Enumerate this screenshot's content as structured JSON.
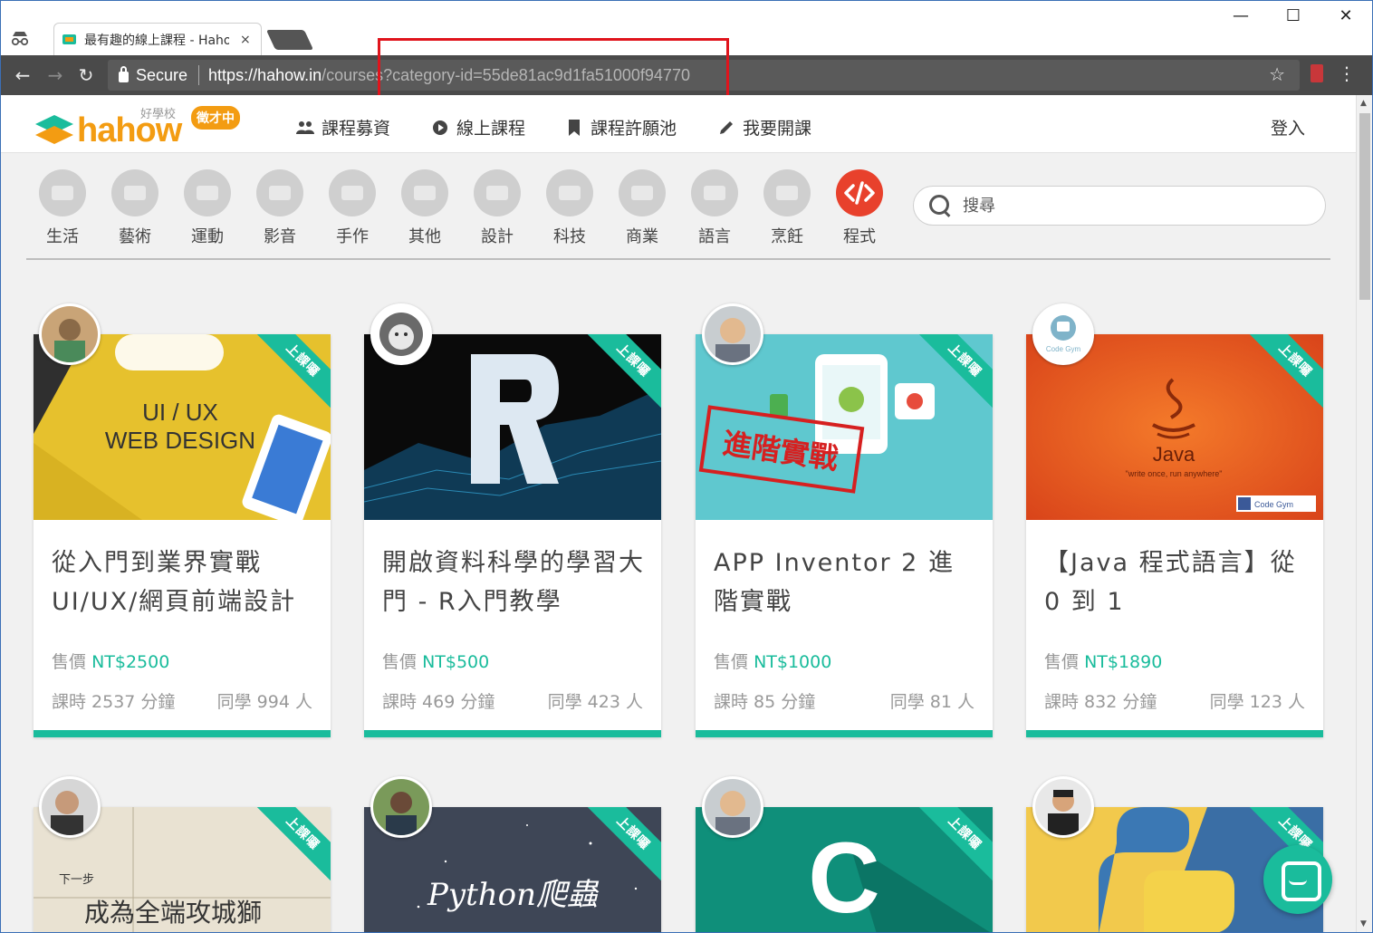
{
  "browser": {
    "tab_title": "最有趣的線上課程 - Hahow",
    "tab_close": "×",
    "secure_label": "Secure",
    "url_host": "https://hahow.in",
    "url_path": "/courses?category-id=55de81ac9d1fa51000f94770",
    "window_minimize": "—",
    "window_maximize": "☐",
    "window_close": "✕"
  },
  "header": {
    "logo_text": "hahow",
    "logo_small": "好學校",
    "logo_badge": "徵才中",
    "nav": [
      {
        "label": "課程募資",
        "icon": "users-icon"
      },
      {
        "label": "線上課程",
        "icon": "play-icon"
      },
      {
        "label": "課程許願池",
        "icon": "bookmark-icon"
      },
      {
        "label": "我要開課",
        "icon": "pencil-icon"
      }
    ],
    "login": "登入"
  },
  "categories": [
    {
      "label": "生活",
      "icon": "life-icon"
    },
    {
      "label": "藝術",
      "icon": "guitar-icon"
    },
    {
      "label": "運動",
      "icon": "shoe-icon"
    },
    {
      "label": "影音",
      "icon": "camera-icon"
    },
    {
      "label": "手作",
      "icon": "scissors-icon"
    },
    {
      "label": "其他",
      "icon": "bomb-icon"
    },
    {
      "label": "設計",
      "icon": "design-icon"
    },
    {
      "label": "科技",
      "icon": "laptop-icon"
    },
    {
      "label": "商業",
      "icon": "briefcase-icon"
    },
    {
      "label": "語言",
      "icon": "chat-bubble-icon"
    },
    {
      "label": "烹飪",
      "icon": "pan-icon"
    },
    {
      "label": "程式",
      "icon": "code-icon",
      "active": true
    }
  ],
  "search": {
    "placeholder": "搜尋"
  },
  "ribbon_label": "上課囉",
  "courses": [
    {
      "title": "從入門到業界實戰UI/UX/網頁前端設計",
      "price_label": "售價",
      "price": "NT$2500",
      "duration": "課時 2537 分鐘",
      "students": "同學 994 人",
      "thumb_text": "UI / UX\nWEB DESIGN"
    },
    {
      "title": "開啟資料科學的學習大門 - R入門教學",
      "price_label": "售價",
      "price": "NT$500",
      "duration": "課時 469 分鐘",
      "students": "同學 423 人",
      "thumb_text": "R"
    },
    {
      "title": "APP Inventor 2 進階實戰",
      "price_label": "售價",
      "price": "NT$1000",
      "duration": "課時 85 分鐘",
      "students": "同學 81 人",
      "thumb_text": "進階實戰"
    },
    {
      "title": "【Java 程式語言】從 0 到 1",
      "price_label": "售價",
      "price": "NT$1890",
      "duration": "課時 832 分鐘",
      "students": "同學 123 人",
      "thumb_text": "Java",
      "thumb_sub": "\"write once, run anywhere\"",
      "avatar_text": "Code Gym"
    },
    {
      "title": "",
      "thumb_text": "成為全端攻城獅",
      "thumb_sub": "下一步"
    },
    {
      "title": "",
      "thumb_text": "Python爬蟲"
    },
    {
      "title": "",
      "thumb_text": "C"
    },
    {
      "title": "",
      "thumb_text": ""
    }
  ],
  "colors": {
    "accent": "#1abc9c",
    "brand": "#f39c12",
    "active_category": "#e8412c",
    "annotation": "#e0141c"
  }
}
